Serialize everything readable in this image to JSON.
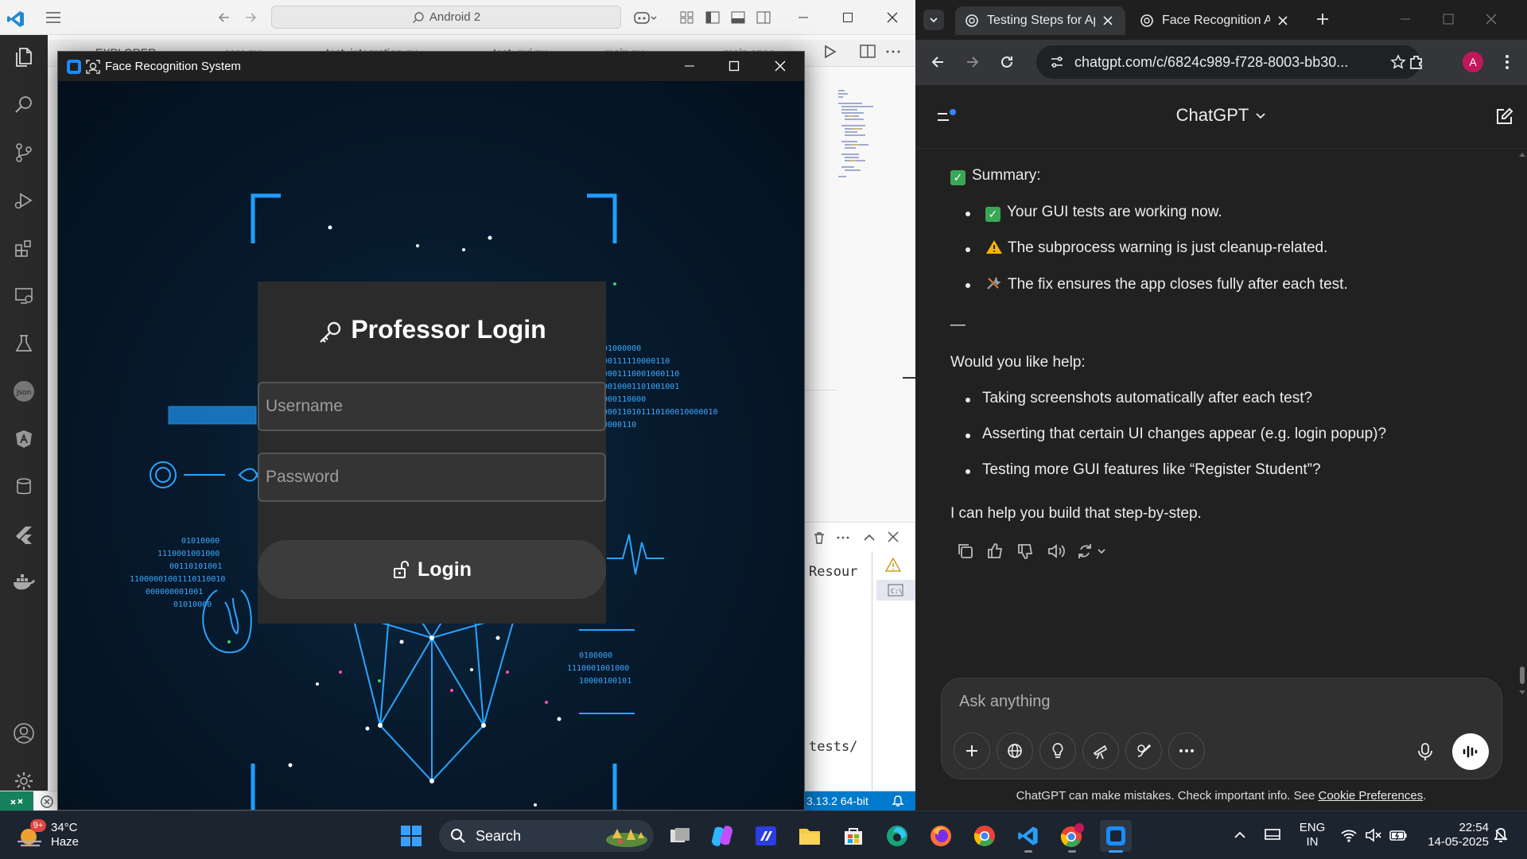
{
  "vscode": {
    "search_text": "Android 2",
    "tabs": [
      "EXPLORER",
      "...core.py",
      "test_integration.py",
      "test_gui.py",
      "main.py",
      "main.spec"
    ],
    "panel_text_1": "Resour",
    "panel_text_2": "tests/",
    "status_python": "3.13.2 64-bit"
  },
  "face_window": {
    "title": "Face Recognition System",
    "login_title": "Professor Login",
    "username_placeholder": "Username",
    "password_placeholder": "Password",
    "login_button": "Login"
  },
  "chrome": {
    "tabs": [
      {
        "title": "Testing Steps for Ap",
        "active": true
      },
      {
        "title": "Face Recognition Ap",
        "active": false
      }
    ],
    "url": "chatgpt.com/c/6824c989-f728-8003-bb30...",
    "profile_initial": "A"
  },
  "chatgpt": {
    "model_label": "ChatGPT",
    "summary_heading": "Summary:",
    "summary_items": [
      {
        "icon": "check",
        "text": "Your GUI tests are working now."
      },
      {
        "icon": "warning",
        "text": "The subprocess warning is just cleanup-related."
      },
      {
        "icon": "tools",
        "text": "The fix ensures the app closes fully after each test."
      }
    ],
    "separator": "—",
    "help_question": "Would you like help:",
    "help_items": [
      "Taking screenshots automatically after each test?",
      "Asserting that certain UI changes appear (e.g. login popup)?",
      "Testing more GUI features like “Register Student”?"
    ],
    "closing": "I can help you build that step-by-step.",
    "composer_placeholder": "Ask anything",
    "disclaimer_text": "ChatGPT can make mistakes. Check important info. See",
    "disclaimer_link": "Cookie Preferences",
    "disclaimer_end": "."
  },
  "taskbar": {
    "weather_temp": "34°C",
    "weather_desc": "Haze",
    "weather_badge": "9+",
    "search_label": "Search",
    "lang_line1": "ENG",
    "lang_line2": "IN",
    "time": "22:54",
    "date": "14-05-2025"
  },
  "colors": {
    "vscode_status_accent": "#007acc",
    "vscode_remote": "#16825d",
    "gpt_bg": "#212121",
    "face_card": "#2b2b2b",
    "hud_blue": "#1e9fff"
  }
}
